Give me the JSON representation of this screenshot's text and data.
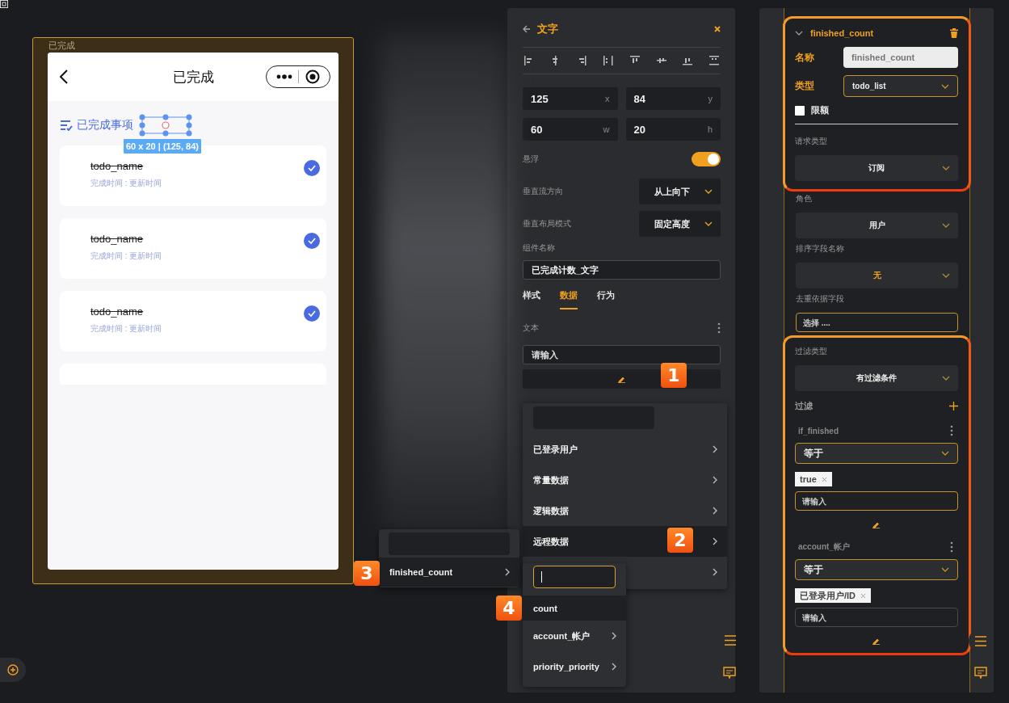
{
  "phone": {
    "frame_label": "已完成",
    "title": "已完成",
    "section_title": "已完成事项",
    "selection_label": "60 x 20 | (125, 84)",
    "items": [
      {
        "name": "todo_name",
        "subtitle": "完成时间 : 更新时间",
        "done": true
      },
      {
        "name": "todo_name",
        "subtitle": "完成时间 : 更新时间",
        "done": true
      },
      {
        "name": "todo_name",
        "subtitle": "完成时间 : 更新时间",
        "done": true
      }
    ]
  },
  "inspector": {
    "title": "文字",
    "position_fields": [
      {
        "value": "125",
        "unit": "x"
      },
      {
        "value": "84",
        "unit": "y"
      },
      {
        "value": "60",
        "unit": "w"
      },
      {
        "value": "20",
        "unit": "h"
      }
    ],
    "float_toggle": {
      "label": "悬浮",
      "on": true
    },
    "selects": [
      {
        "label": "垂直流方向",
        "value": "从上向下"
      },
      {
        "label": "垂直布局模式",
        "value": "固定高度"
      }
    ],
    "component_name": {
      "label": "组件名称",
      "value": "已完成计数_文字"
    },
    "tabs": [
      {
        "label": "样式",
        "selected": false
      },
      {
        "label": "数据",
        "selected": true
      },
      {
        "label": "行为",
        "selected": false
      }
    ],
    "text_field": {
      "label": "文本",
      "placeholder": "请输入",
      "step": "1"
    }
  },
  "data_menu": {
    "items": [
      {
        "label": "已登录用户",
        "selected": false
      },
      {
        "label": "常量数据",
        "selected": false
      },
      {
        "label": "逻辑数据",
        "selected": false
      },
      {
        "label": "远程数据",
        "selected": true,
        "step": "2"
      }
    ]
  },
  "remote_menu": {
    "items": [
      {
        "label": "finished_count",
        "selected": true,
        "step": "3"
      }
    ]
  },
  "field_menu": {
    "items": [
      {
        "label": "count",
        "selected": true,
        "has_children": false,
        "step": "4"
      },
      {
        "label": "account_帐户",
        "selected": false,
        "has_children": true
      },
      {
        "label": "priority_priority",
        "selected": false,
        "has_children": true
      }
    ]
  },
  "data_source": {
    "name": "finished_count",
    "name_label": "名称",
    "name_value": "finished_count",
    "type_label": "类型",
    "type_value": "todo_list",
    "limit": {
      "label": "限额",
      "checked": false
    },
    "request": {
      "label": "请求类型",
      "value": "订阅",
      "accent": false
    },
    "selects": [
      {
        "label": "角色",
        "value": "用户",
        "accent": false
      },
      {
        "label": "排序字段名称",
        "value": "无",
        "accent": true
      }
    ],
    "dedupe": {
      "label": "去重依据字段",
      "placeholder": "选择 ...."
    },
    "filter_type": {
      "label": "过滤类型",
      "value": "有过滤条件",
      "accent": false
    },
    "filter_label": "过滤",
    "filters": [
      {
        "field": "if_finished",
        "operator": "等于",
        "tag": "true",
        "placeholder": "请输入",
        "focused": true
      },
      {
        "field": "account_帐户",
        "operator": "等于",
        "tag": "已登录用户/ID",
        "placeholder": "请输入",
        "focused": false
      }
    ]
  }
}
